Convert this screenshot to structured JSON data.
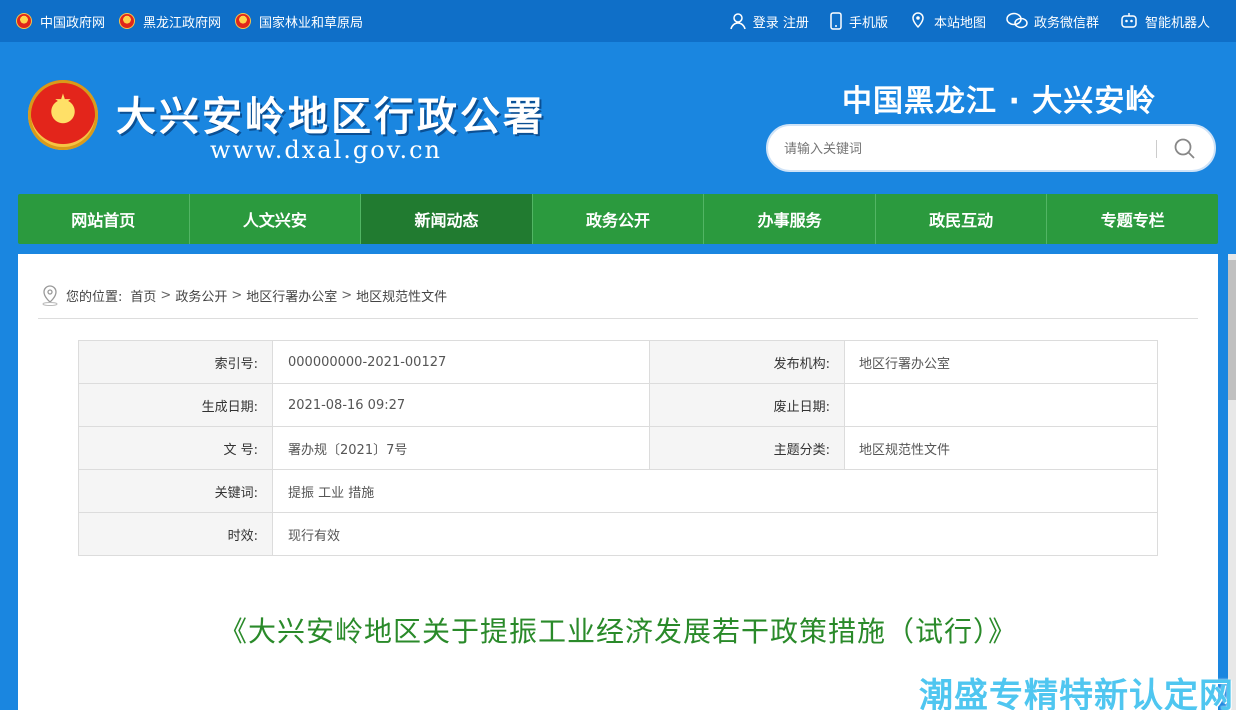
{
  "topbar": {
    "left_links": [
      {
        "label": "中国政府网",
        "icon": "emblem-icon"
      },
      {
        "label": "黑龙江政府网",
        "icon": "emblem-icon"
      },
      {
        "label": "国家林业和草原局",
        "icon": "emblem-icon"
      }
    ],
    "right_links": [
      {
        "label": "登录 注册",
        "icon": "user-icon"
      },
      {
        "label": "手机版",
        "icon": "phone-icon"
      },
      {
        "label": "本站地图",
        "icon": "map-icon"
      },
      {
        "label": "政务微信群",
        "icon": "wechat-icon"
      },
      {
        "label": "智能机器人",
        "icon": "robot-icon"
      }
    ]
  },
  "header": {
    "site_title": "大兴安岭地区行政公署",
    "site_url": "www.dxal.gov.cn",
    "region_title": "中国黑龙江 · 大兴安岭",
    "search_placeholder": "请输入关键词"
  },
  "nav": {
    "items": [
      "网站首页",
      "人文兴安",
      "新闻动态",
      "政务公开",
      "办事服务",
      "政民互动",
      "专题专栏"
    ],
    "active": "新闻动态"
  },
  "breadcrumb": {
    "prefix": "您的位置:",
    "items": [
      "首页",
      "政务公开",
      "地区行署办公室",
      "地区规范性文件"
    ]
  },
  "meta": {
    "index_no_label": "索引号:",
    "index_no": "000000000-2021-00127",
    "publisher_label": "发布机构:",
    "publisher": "地区行署办公室",
    "created_label": "生成日期:",
    "created": "2021-08-16 09:27",
    "abolished_label": "废止日期:",
    "abolished": "",
    "doc_no_label": "文 号:",
    "doc_no": "署办规〔2021〕7号",
    "topic_label": "主题分类:",
    "topic": "地区规范性文件",
    "keywords_label": "关键词:",
    "keywords": "提振 工业 措施",
    "validity_label": "时效:",
    "validity": "现行有效"
  },
  "document": {
    "title": "《大兴安岭地区关于提振工业经济发展若干政策措施（试行）》"
  },
  "watermark": "潮盛专精特新认定网",
  "colors": {
    "header_blue": "#1a86e0",
    "topbar_blue": "#0f6fc8",
    "nav_green": "#2b9a3e",
    "title_green": "#2a8a2a"
  }
}
